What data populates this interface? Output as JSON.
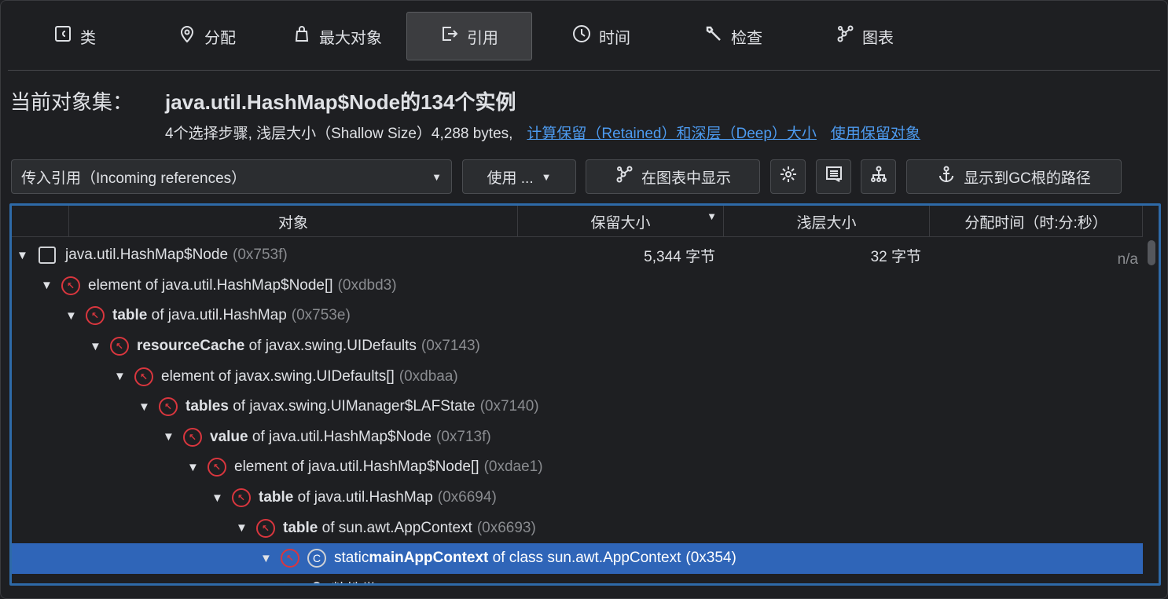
{
  "tabs": [
    {
      "label": "类",
      "icon": "class-icon"
    },
    {
      "label": "分配",
      "icon": "location-pin-icon"
    },
    {
      "label": "最大对象",
      "icon": "bag-icon"
    },
    {
      "label": "引用",
      "icon": "export-icon"
    },
    {
      "label": "时间",
      "icon": "clock-icon"
    },
    {
      "label": "检查",
      "icon": "wrench-icon"
    },
    {
      "label": "图表",
      "icon": "graph-icon"
    }
  ],
  "header": {
    "label": "当前对象集：",
    "title": "java.util.HashMap$Node的134个实例",
    "summary": "4个选择步骤, 浅层大小（Shallow Size）4,288 bytes,",
    "link_retained": "计算保留（Retained）和深层（Deep）大小",
    "link_use_retained": "使用保留对象"
  },
  "toolbar": {
    "view_select": "传入引用（Incoming references）",
    "use_label": "使用 ...",
    "show_graph": "在图表中显示",
    "gc_path": "显示到GC根的路径"
  },
  "columns": [
    "对象",
    "保留大小",
    "浅层大小",
    "分配时间（时:分:秒）"
  ],
  "rows": [
    {
      "bold": "",
      "text": "java.util.HashMap$Node",
      "addr": "(0x753f)",
      "retained": "5,344 字节",
      "shallow": "32 字节",
      "time": "n/a"
    },
    {
      "bold": "",
      "text": "element of java.util.HashMap$Node[]",
      "addr": "(0xdbd3)"
    },
    {
      "bold": "table",
      "text": " of java.util.HashMap",
      "addr": "(0x753e)"
    },
    {
      "bold": "resourceCache",
      "text": " of javax.swing.UIDefaults",
      "addr": "(0x7143)"
    },
    {
      "bold": "",
      "text": "element of javax.swing.UIDefaults[]",
      "addr": "(0xdbaa)"
    },
    {
      "bold": "tables",
      "text": " of javax.swing.UIManager$LAFState",
      "addr": "(0x7140)"
    },
    {
      "bold": "value",
      "text": " of java.util.HashMap$Node",
      "addr": "(0x713f)"
    },
    {
      "bold": "",
      "text": "element of java.util.HashMap$Node[]",
      "addr": "(0xdae1)"
    },
    {
      "bold": "table",
      "text": " of java.util.HashMap",
      "addr": "(0x6694)"
    },
    {
      "bold": "table",
      "text": " of sun.awt.AppContext",
      "addr": "(0x6693)"
    },
    {
      "prefix": "static ",
      "bold": "mainAppContext",
      "text": " of class sun.awt.AppContext",
      "addr": "(0x354)"
    },
    {
      "bold": "",
      "text": "粘性类(sticky)",
      "addr": ""
    }
  ]
}
